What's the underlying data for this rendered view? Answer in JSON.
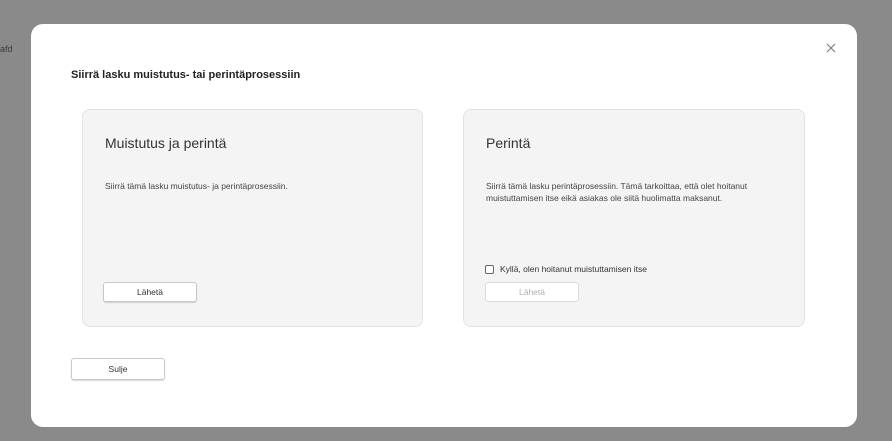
{
  "background": {
    "partial_text": "afd"
  },
  "modal": {
    "title": "Siirrä lasku muistutus- tai perintäprosessiin",
    "close_label": "Sulje",
    "cards": [
      {
        "title": "Muistutus ja perintä",
        "description": "Siirrä tämä lasku muistutus- ja perintäprosessiin.",
        "send_label": "Lähetä"
      },
      {
        "title": "Perintä",
        "description": "Siirrä tämä lasku perintäprosessiin. Tämä tarkoittaa, että olet hoitanut muistuttamisen itse eikä asiakas ole siitä huolimatta maksanut.",
        "checkbox_label": "Kyllä, olen hoitanut muistuttamisen itse",
        "checkbox_checked": false,
        "send_label": "Lähetä"
      }
    ]
  },
  "icons": {
    "close": "close-icon"
  },
  "colors": {
    "backdrop": "#8a8a8a",
    "card_bg": "#f4f4f5",
    "disabled_text": "#b0b0b0"
  }
}
